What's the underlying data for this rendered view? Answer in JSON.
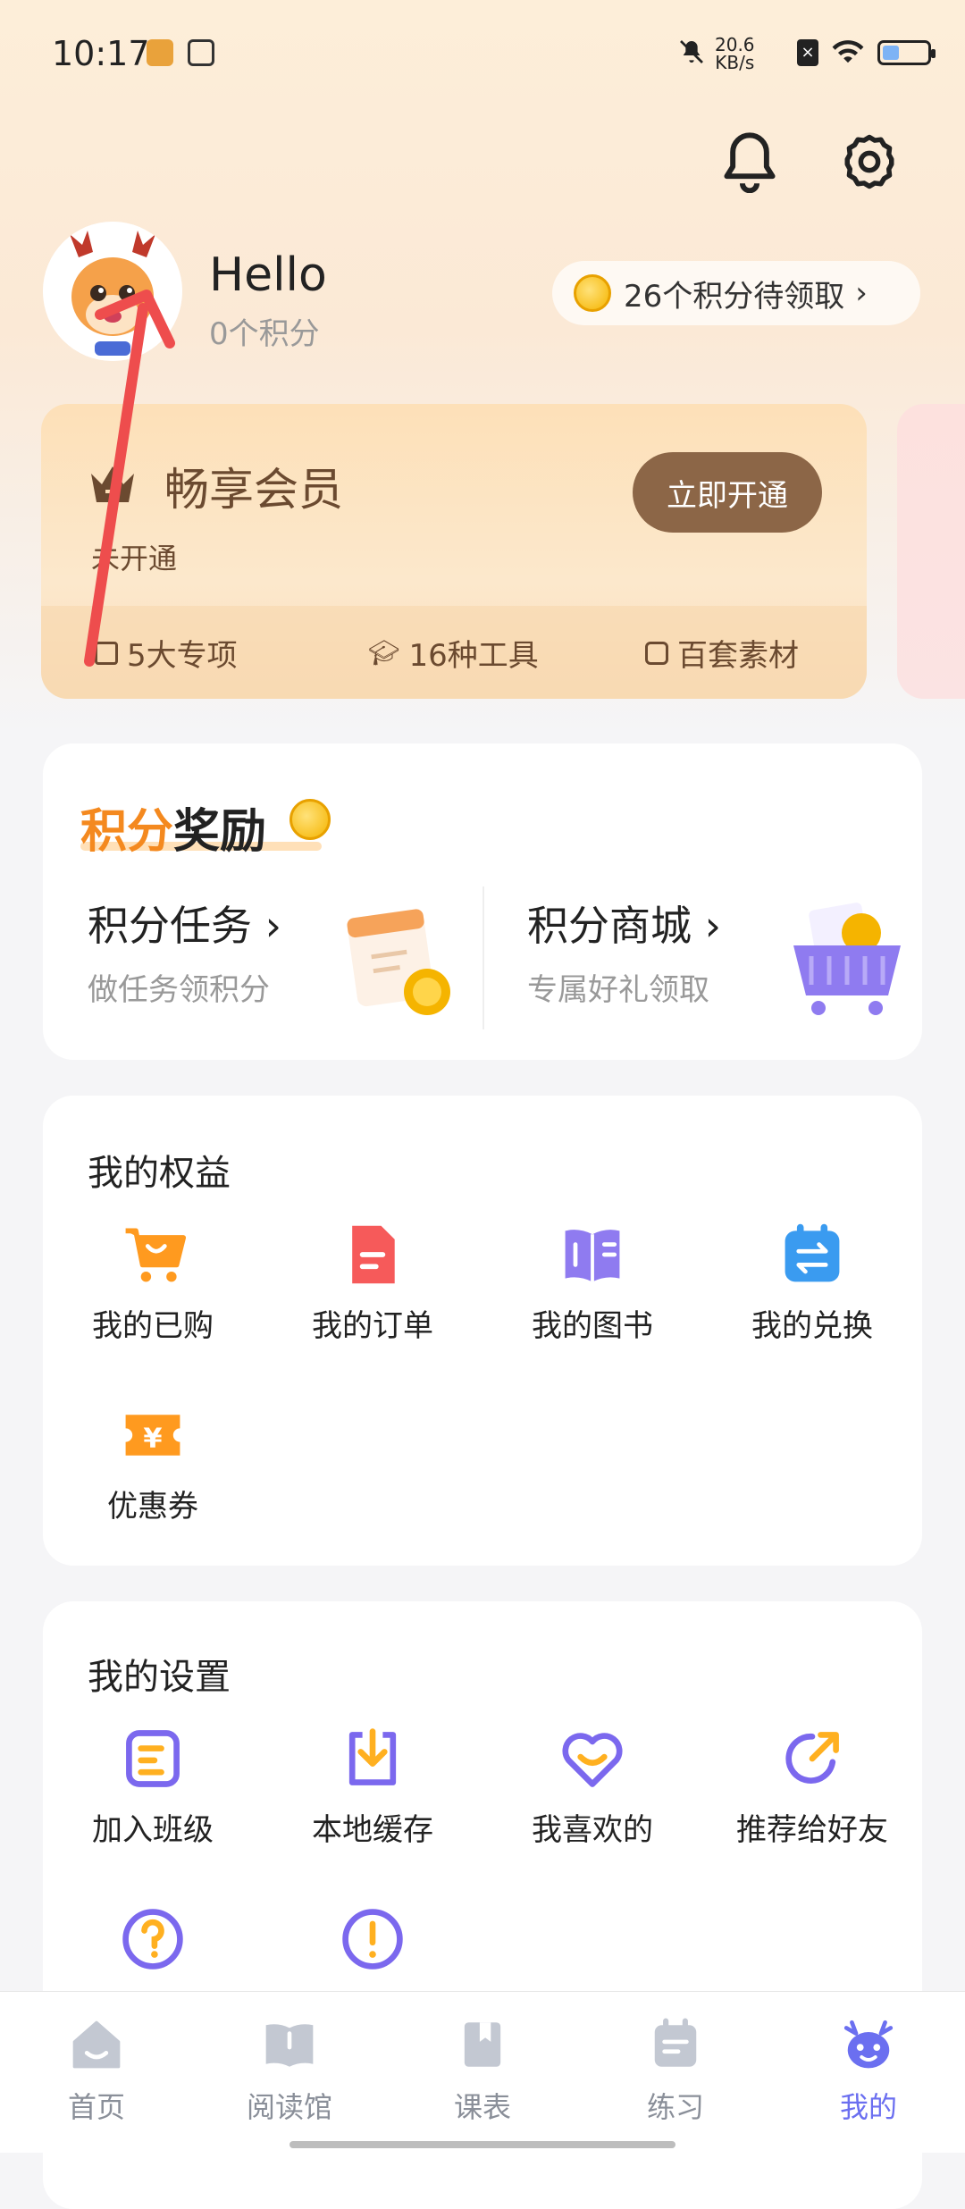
{
  "status_bar": {
    "time": "10:17",
    "net_speed_value": "20.6",
    "net_speed_unit": "KB/s"
  },
  "header": {
    "icons": [
      "bell-icon",
      "gear-icon"
    ]
  },
  "profile": {
    "greeting": "Hello",
    "points": "0个积分",
    "pending_points": "26个积分待领取"
  },
  "membership": {
    "title": "畅享会员",
    "status": "未开通",
    "cta": "立即开通",
    "features": [
      "5大专项",
      "16种工具",
      "百套素材"
    ]
  },
  "rewards": {
    "title_part1": "积分",
    "title_part2": "奖励",
    "items": [
      {
        "name": "积分任务",
        "sub": "做任务领积分"
      },
      {
        "name": "积分商城",
        "sub": "专属好礼领取"
      }
    ]
  },
  "rights": {
    "title": "我的权益",
    "items": [
      "我的已购",
      "我的订单",
      "我的图书",
      "我的兑换",
      "优惠券"
    ]
  },
  "settings": {
    "title": "我的设置",
    "items": [
      "加入班级",
      "本地缓存",
      "我喜欢的",
      "推荐给好友"
    ]
  },
  "bottom_nav": {
    "items": [
      "首页",
      "阅读馆",
      "课表",
      "练习",
      "我的"
    ],
    "active": "我的"
  },
  "colors": {
    "accent": "#6b6ff0",
    "member_brown": "#8c6647",
    "reward_orange": "#f4891f"
  }
}
